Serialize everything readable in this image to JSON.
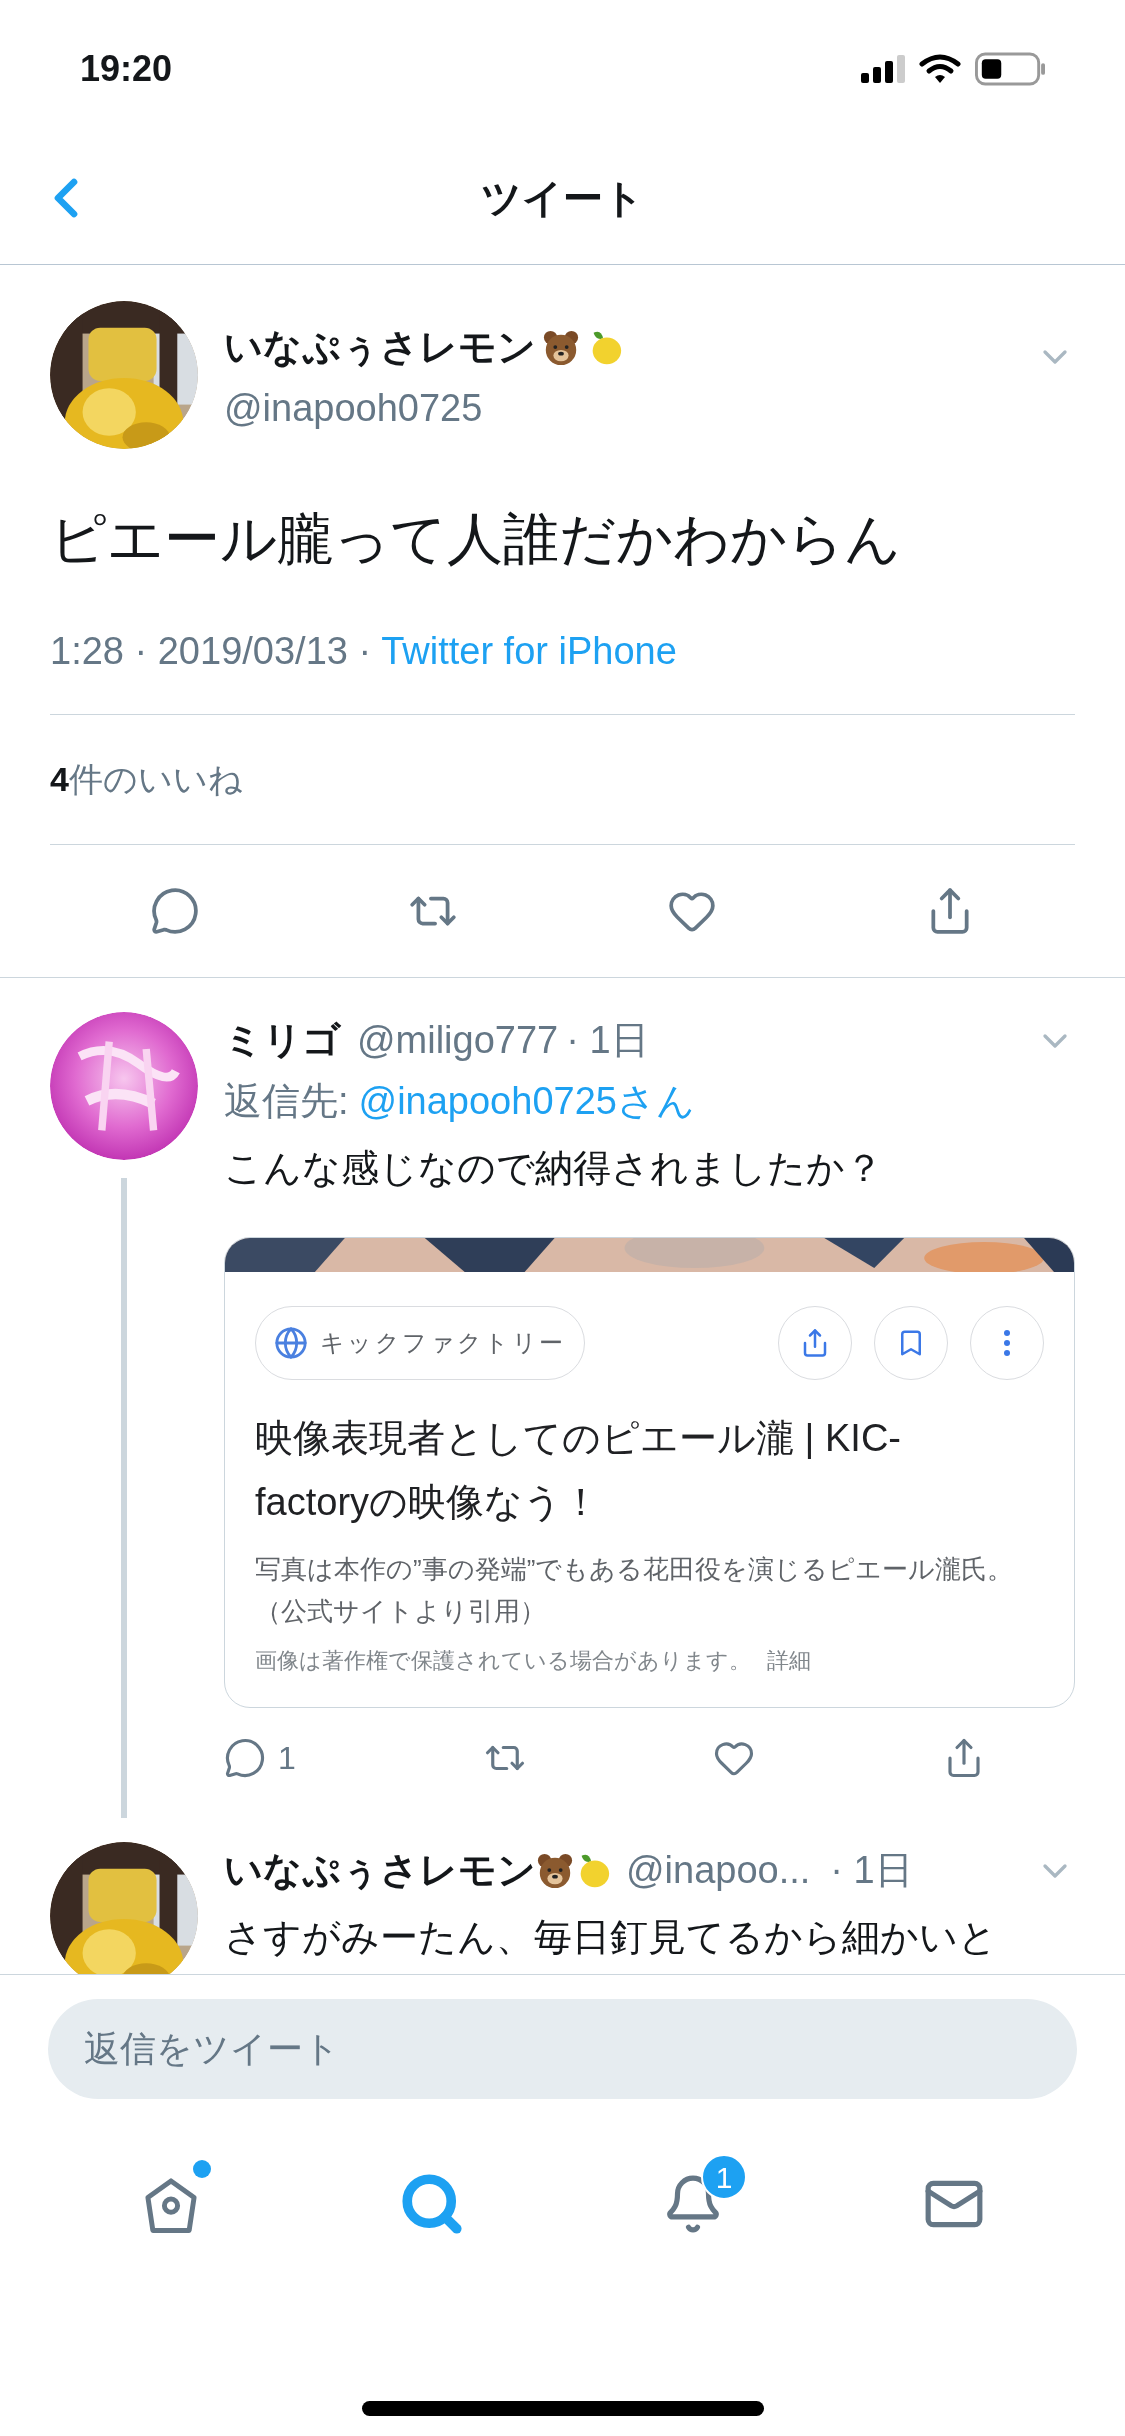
{
  "status_bar": {
    "time": "19:20"
  },
  "nav": {
    "title": "ツイート"
  },
  "tweet": {
    "author": {
      "name": "いなぷぅさレモン",
      "handle": "@inapooh0725"
    },
    "text": "ピエール朧って人誰だかわからん",
    "time": "1:28 · 2019/03/13 ·",
    "source": "Twitter for iPhone",
    "likes": "**4**件のいいね"
  },
  "replies": [
    {
      "kind": "other",
      "name": "ミリゴ",
      "handle": "@miligo777",
      "time": "· 1日",
      "reply_to_label": "返信先:",
      "reply_to": "@inapooh0725さん",
      "text": "こんな感じなので納得されましたか？",
      "card": {
        "source": "キックファクトリー",
        "title": "映像表現者としてのピエール瀧 | KIC-factoryの映像なう！",
        "description": "写真は本作の”事の発端”でもある花田役を演じるピエール瀧氏。（公式サイトより引用）",
        "notice": "画像は著作権で保護されている場合があります。",
        "notice_link": "詳細"
      },
      "reply_count": "1"
    },
    {
      "kind": "author",
      "name": "いなぷぅさレモン",
      "handle": "@inapoo...",
      "time": "· 1日",
      "text": "さすがみーたん、毎日釘見てるから細かいと"
    }
  ],
  "reply_field": {
    "placeholder": "返信をツイート"
  },
  "tab_bar": [
    {
      "kind": "home",
      "selected": false,
      "unread": true
    },
    {
      "kind": "search",
      "selected": true,
      "unread": false
    },
    {
      "kind": "notifications",
      "selected": false,
      "unread": false,
      "badge": "1"
    },
    {
      "kind": "messages",
      "selected": false,
      "unread": false
    }
  ]
}
